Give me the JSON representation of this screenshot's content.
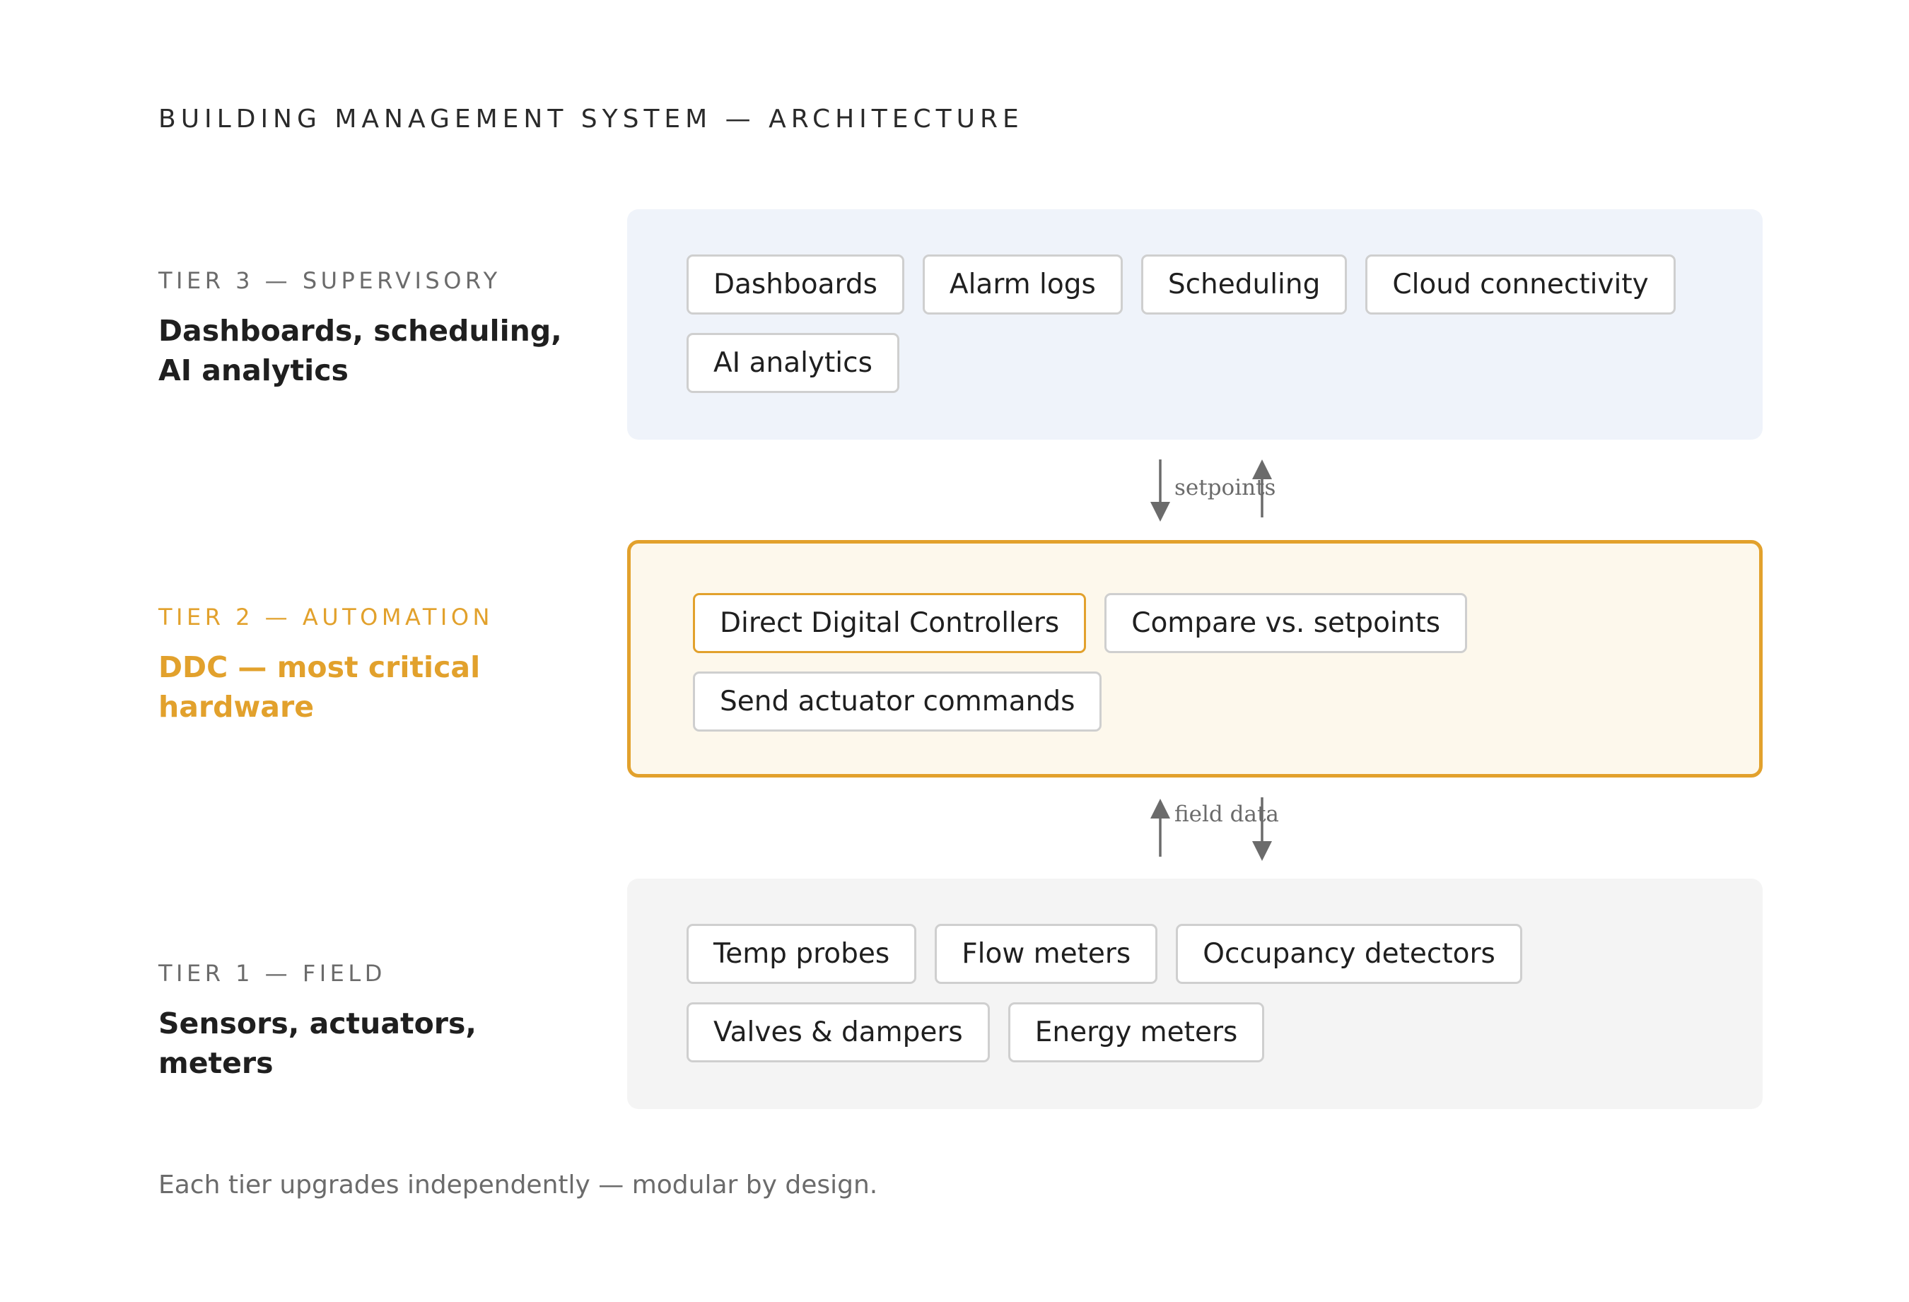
{
  "title": "BUILDING MANAGEMENT SYSTEM — ARCHITECTURE",
  "colors": {
    "accent": "#e2a12c",
    "tier3_bg": "#eff3fa",
    "tier2_bg": "#fdf8ec",
    "tier1_bg": "#f4f4f4",
    "arrow": "#6b6b6b"
  },
  "tiers": [
    {
      "eyebrow": "TIER 3 — SUPERVISORY",
      "description": "Dashboards, scheduling, AI analytics",
      "items": [
        "Dashboards",
        "Alarm logs",
        "Scheduling",
        "Cloud connectivity",
        "AI analytics"
      ]
    },
    {
      "eyebrow": "TIER 2 — AUTOMATION",
      "description": "DDC — most critical hardware",
      "highlighted": true,
      "items": [
        "Direct Digital Controllers",
        "Compare vs. setpoints",
        "Send actuator commands"
      ]
    },
    {
      "eyebrow": "TIER 1 — FIELD",
      "description": "Sensors, actuators, meters",
      "items": [
        "Temp probes",
        "Flow meters",
        "Occupancy detectors",
        "Valves & dampers",
        "Energy meters"
      ]
    }
  ],
  "connections": [
    {
      "label": "setpoints"
    },
    {
      "label": "field data"
    }
  ],
  "footnote": "Each tier upgrades independently — modular by design."
}
